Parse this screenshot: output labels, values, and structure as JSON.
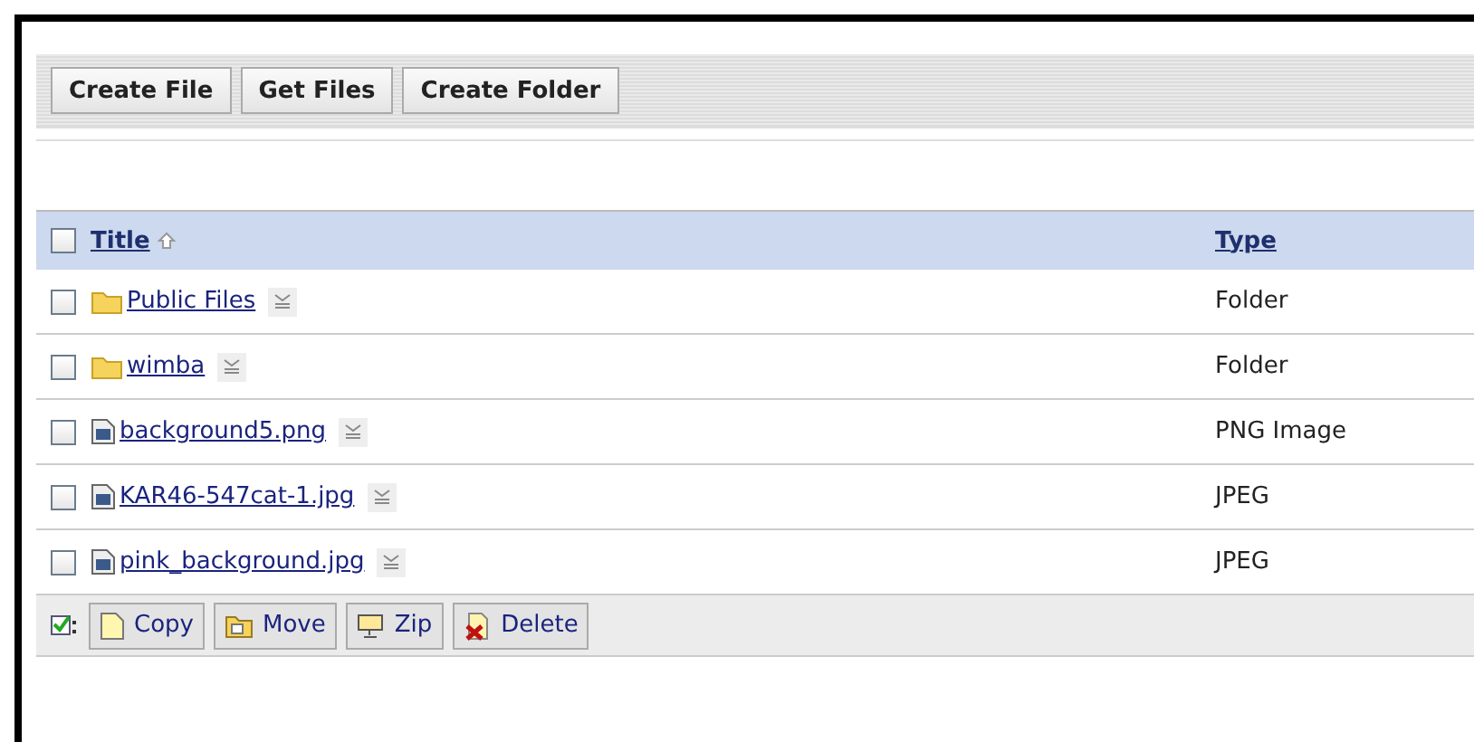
{
  "toolbar": {
    "buttons": [
      "Create File",
      "Get Files",
      "Create Folder"
    ]
  },
  "table": {
    "columns": [
      {
        "label": "Title",
        "sorted": true
      },
      {
        "label": "Type",
        "sorted": false
      }
    ],
    "header_checkbox": {
      "checked": false
    },
    "rows": [
      {
        "kind": "folder",
        "name": "Public Files",
        "type": "Folder",
        "checked": false
      },
      {
        "kind": "folder",
        "name": "wimba",
        "type": "Folder",
        "checked": false
      },
      {
        "kind": "file",
        "name": "background5.png",
        "type": "PNG Image",
        "checked": false
      },
      {
        "kind": "file",
        "name": "KAR46-547cat-1.jpg",
        "type": "JPEG",
        "checked": false
      },
      {
        "kind": "file",
        "name": "pink_background.jpg",
        "type": "JPEG",
        "checked": false
      }
    ]
  },
  "actions": [
    {
      "kind": "copy",
      "label": "Copy"
    },
    {
      "kind": "move",
      "label": "Move"
    },
    {
      "kind": "zip",
      "label": "Zip"
    },
    {
      "kind": "delete",
      "label": "Delete"
    }
  ]
}
